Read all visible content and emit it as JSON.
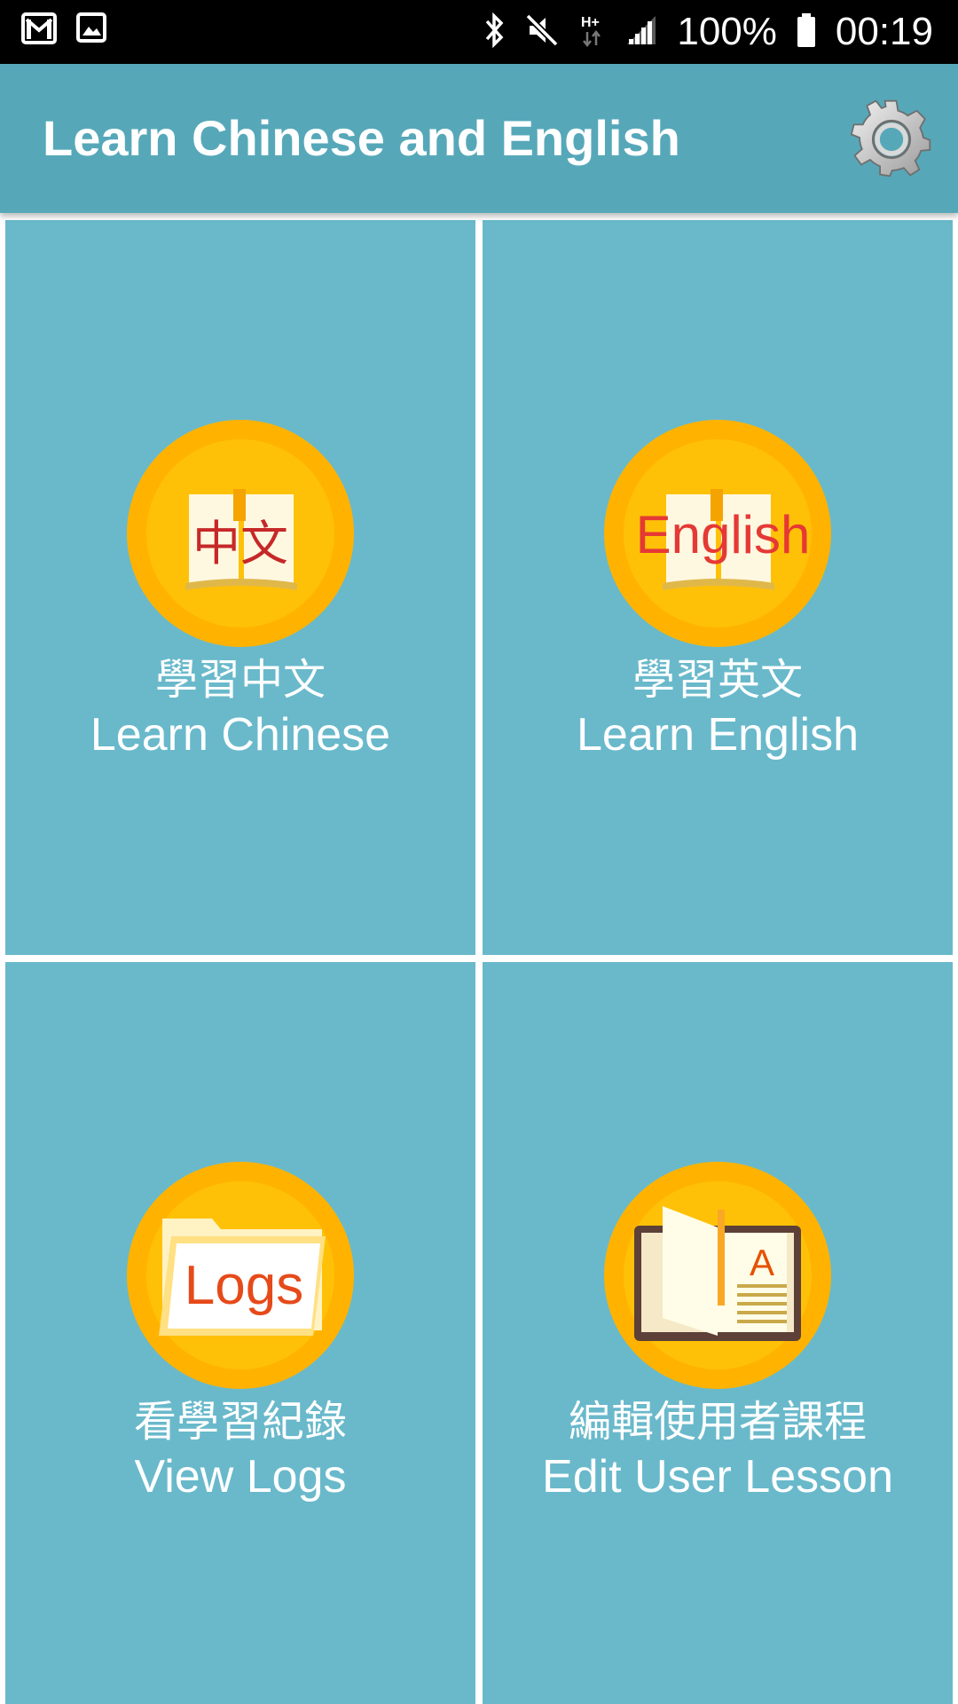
{
  "status_bar": {
    "left_icons": [
      "gmail-icon",
      "gallery-icon"
    ],
    "right_icons": [
      "bluetooth-icon",
      "mute-icon",
      "network-hplus-icon",
      "signal-icon",
      "battery-icon"
    ],
    "network_label": "H+",
    "battery": "100%",
    "time": "00:19"
  },
  "app_bar": {
    "title": "Learn Chinese and English",
    "settings_icon": "gear-icon"
  },
  "tiles": [
    {
      "icon": "chinese-book-icon",
      "icon_text": "中文",
      "label_zh": "學習中文",
      "label_en": "Learn Chinese"
    },
    {
      "icon": "english-book-icon",
      "icon_text": "English",
      "label_zh": "學習英文",
      "label_en": "Learn English"
    },
    {
      "icon": "logs-folder-icon",
      "icon_text": "Logs",
      "label_zh": "看學習紀錄",
      "label_en": "View Logs"
    },
    {
      "icon": "lesson-book-icon",
      "icon_text": "A",
      "label_zh": "編輯使用者課程",
      "label_en": "Edit User Lesson"
    }
  ],
  "colors": {
    "status_bar": "#000000",
    "app_bar": "#56a8b9",
    "tile": "#69b9cb",
    "divider": "#ffffff",
    "icon_circle_outer": "#ffb300",
    "icon_circle_inner": "#ffc107",
    "icon_text_red": "#c62828"
  }
}
